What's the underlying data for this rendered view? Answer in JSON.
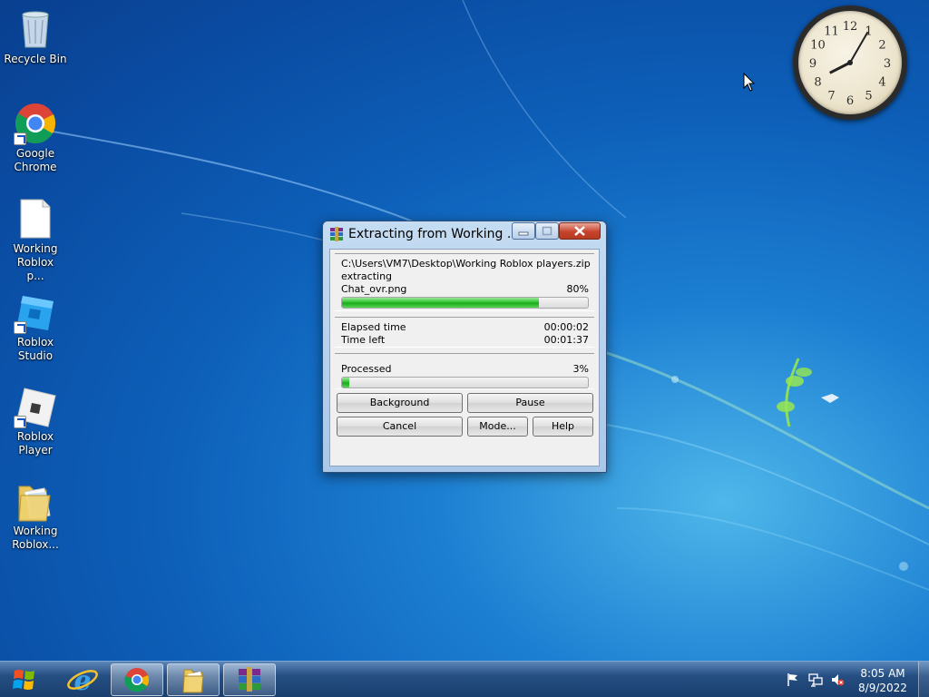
{
  "desktop": {
    "icons": [
      {
        "label": "Recycle Bin",
        "icon": "recycle-bin-icon"
      },
      {
        "label": "Google Chrome",
        "icon": "chrome-icon"
      },
      {
        "label": "Working Roblox p...",
        "icon": "document-icon"
      },
      {
        "label": "Roblox Studio",
        "icon": "roblox-studio-icon"
      },
      {
        "label": "Roblox Player",
        "icon": "roblox-player-icon"
      },
      {
        "label": "Working Roblox...",
        "icon": "folder-icon"
      }
    ]
  },
  "dialog": {
    "title": "Extracting from Working ...",
    "archive_path": "C:\\Users\\VM7\\Desktop\\Working Roblox players.zip",
    "action": "extracting",
    "current_file": "Chat_ovr.png",
    "file_percent_label": "80%",
    "file_progress": 0.8,
    "elapsed_label": "Elapsed time",
    "elapsed_value": "00:00:02",
    "timeleft_label": "Time left",
    "timeleft_value": "00:01:37",
    "processed_label": "Processed",
    "processed_percent_label": "3%",
    "processed_progress": 0.03,
    "buttons": {
      "background": "Background",
      "pause": "Pause",
      "cancel": "Cancel",
      "mode": "Mode...",
      "help": "Help"
    }
  },
  "taskbar": {
    "pinned": [
      {
        "icon": "internet-explorer-icon"
      },
      {
        "icon": "chrome-icon"
      },
      {
        "icon": "folder-icon"
      },
      {
        "icon": "winrar-icon"
      }
    ],
    "tray": {
      "time": "8:05 AM",
      "date": "8/9/2022"
    }
  },
  "clock_gadget": {
    "numbers": [
      "12",
      "1",
      "2",
      "3",
      "4",
      "5",
      "6",
      "7",
      "8",
      "9",
      "10",
      "11"
    ],
    "time": "8:05"
  },
  "colors": {
    "progress_green": "#2ec52c",
    "taskbar": "#1a3f6e",
    "desktop": "#0d5fb8"
  }
}
